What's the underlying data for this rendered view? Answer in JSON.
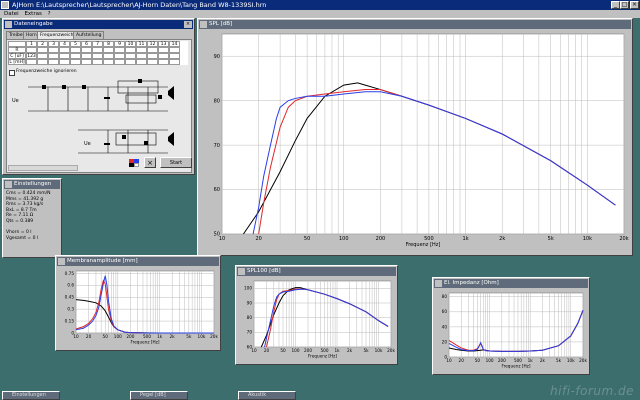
{
  "app": {
    "title": "AJHorn  E:\\Lautsprecher\\Lautsprecher\\AJ-Horn Daten\\Tang Band W8-1339SI.hrn"
  },
  "menu": [
    "Datei",
    "Extras",
    "?"
  ],
  "sidebar_controls": [
    "_",
    "□",
    "×"
  ],
  "data_window": {
    "title": "Dateneingabe",
    "tabs": [
      "Treiber",
      "Horn",
      "Frequenzweiche",
      "Aufstellung"
    ],
    "grid_cols": [
      "1",
      "2",
      "3",
      "4",
      "5",
      "6",
      "7",
      "8",
      "9",
      "10",
      "11",
      "12",
      "13",
      "14"
    ],
    "grid_rows": [
      "R [Ohm]",
      "C [uF]",
      "L [mH]"
    ],
    "c_value": "123",
    "checkbox_label": "Frequenzweiche ignorieren",
    "input_label_1": "Ue",
    "input_label_2": "Ue",
    "start_button": "Start",
    "close_button": "×"
  },
  "params_window": {
    "title": "Einstellungen",
    "lines": [
      "Cms = 0.424 mm/N",
      "Mms = 41.392 g",
      "Rms = 3.73 kg/s",
      "BxL = 8.7 Tm",
      "Re = 7.11 Ω",
      "Qts = 0.389",
      "",
      "Vhorn = 0 l",
      "Vgesamt = 0 l"
    ]
  },
  "colors": {
    "blue": "#2a3ee8",
    "red": "#e0282c",
    "black": "#000000",
    "bg": "#3d6e6e"
  },
  "charts": {
    "spl": {
      "title": "SPL [dB]",
      "xlabel": "Frequenz [Hz]",
      "x_ticks": [
        "10",
        "20",
        "50",
        "100",
        "200",
        "500",
        "1k",
        "2k",
        "5k",
        "10k",
        "20k"
      ],
      "y_ticks": [
        "50",
        "60",
        "70",
        "80",
        "90"
      ]
    },
    "excursion": {
      "title": "Membranamplitude [mm]",
      "xlabel": "Frequenz [Hz]",
      "x_ticks": [
        "10",
        "20",
        "50",
        "100",
        "200",
        "500",
        "1k",
        "2k",
        "5k",
        "10k",
        "20k"
      ],
      "y_ticks": [
        "0",
        "0.15",
        "0.3",
        "0.45",
        "0.6",
        "0.75"
      ]
    },
    "spl_small": {
      "title": "SPL100 [dB]",
      "xlabel": "Frequenz [Hz]",
      "x_ticks": [
        "10",
        "20",
        "50",
        "100",
        "200",
        "500",
        "1k",
        "2k",
        "5k",
        "10k",
        "20k"
      ],
      "y_ticks": [
        "60",
        "70",
        "80",
        "90",
        "100"
      ]
    },
    "impedance": {
      "title": "El. Impedanz [Ohm]",
      "xlabel": "Frequenz [Hz]",
      "x_ticks": [
        "10",
        "20",
        "50",
        "100",
        "200",
        "500",
        "1k",
        "2k",
        "5k",
        "10k",
        "20k"
      ],
      "y_ticks": [
        "0",
        "20",
        "40",
        "60",
        "80"
      ]
    }
  },
  "chart_data": [
    {
      "type": "line",
      "title": "SPL [dB]",
      "xlabel": "Frequenz [Hz]",
      "ylabel": "",
      "xscale": "log",
      "xlim": [
        10,
        20000
      ],
      "ylim": [
        50,
        95
      ],
      "series": [
        {
          "color": "#000000",
          "x": [
            15,
            20,
            30,
            40,
            50,
            70,
            100,
            130,
            150,
            200,
            300,
            500,
            1000,
            2000,
            5000,
            10000,
            17000
          ],
          "y": [
            50,
            55,
            64,
            71,
            76,
            81,
            83.5,
            84,
            83.5,
            82.5,
            81,
            79,
            76,
            72.5,
            66.5,
            61,
            56.5
          ]
        },
        {
          "color": "#e0282c",
          "x": [
            20,
            22,
            25,
            30,
            35,
            40,
            50,
            70,
            100,
            150,
            200,
            300,
            500,
            1000,
            2000,
            5000,
            10000,
            17000
          ],
          "y": [
            50,
            57,
            65,
            74,
            78.5,
            80,
            81,
            81.5,
            82,
            82.5,
            82.5,
            81,
            79,
            76,
            72.5,
            66.5,
            61,
            56.5
          ]
        },
        {
          "color": "#2a3ee8",
          "x": [
            18,
            20,
            22,
            25,
            28,
            30,
            35,
            40,
            50,
            70,
            100,
            150,
            200,
            300,
            500,
            1000,
            2000,
            5000,
            10000,
            17000
          ],
          "y": [
            50,
            56,
            63,
            70,
            76,
            78.5,
            80,
            80.5,
            81,
            81,
            81.5,
            82,
            82,
            81,
            79,
            76,
            72.5,
            66.5,
            61,
            56.5
          ]
        }
      ]
    },
    {
      "type": "line",
      "title": "Membranamplitude [mm]",
      "xlabel": "Frequenz [Hz]",
      "xscale": "log",
      "xlim": [
        10,
        20000
      ],
      "ylim": [
        0,
        0.78
      ],
      "series": [
        {
          "color": "#000000",
          "x": [
            10,
            15,
            20,
            30,
            40,
            50,
            60,
            70,
            80,
            100,
            150,
            200,
            500,
            1000,
            20000
          ],
          "y": [
            0.42,
            0.41,
            0.4,
            0.38,
            0.34,
            0.28,
            0.2,
            0.13,
            0.08,
            0.04,
            0.01,
            0.005,
            0.001,
            0,
            0
          ]
        },
        {
          "color": "#e0282c",
          "x": [
            10,
            15,
            20,
            25,
            30,
            35,
            40,
            45,
            50,
            55,
            60,
            70,
            80,
            100,
            150,
            200,
            500,
            20000
          ],
          "y": [
            0.05,
            0.08,
            0.12,
            0.18,
            0.26,
            0.38,
            0.55,
            0.66,
            0.62,
            0.45,
            0.3,
            0.15,
            0.08,
            0.04,
            0.01,
            0.005,
            0,
            0
          ]
        },
        {
          "color": "#2a3ee8",
          "x": [
            10,
            15,
            20,
            25,
            30,
            35,
            40,
            45,
            50,
            55,
            60,
            70,
            80,
            100,
            150,
            200,
            500,
            20000
          ],
          "y": [
            0.04,
            0.06,
            0.1,
            0.15,
            0.22,
            0.32,
            0.48,
            0.62,
            0.72,
            0.6,
            0.4,
            0.18,
            0.09,
            0.04,
            0.01,
            0.005,
            0,
            0
          ]
        }
      ]
    },
    {
      "type": "line",
      "title": "SPL100 [dB]",
      "xlabel": "Frequenz [Hz]",
      "xscale": "log",
      "xlim": [
        10,
        20000
      ],
      "ylim": [
        60,
        105
      ],
      "series": [
        {
          "color": "#000000",
          "x": [
            15,
            20,
            30,
            40,
            50,
            70,
            100,
            130,
            200,
            500,
            1000,
            2000,
            5000,
            10000,
            17000
          ],
          "y": [
            60,
            68,
            82,
            90,
            95,
            99,
            100.5,
            100.5,
            99,
            96,
            93,
            89.5,
            84,
            78,
            74
          ]
        },
        {
          "color": "#e0282c",
          "x": [
            20,
            25,
            30,
            35,
            40,
            50,
            70,
            100,
            150,
            200,
            500,
            1000,
            2000,
            5000,
            10000,
            17000
          ],
          "y": [
            60,
            72,
            84,
            92,
            96,
            98,
            98.5,
            99.5,
            99.5,
            99,
            96,
            93,
            89.5,
            84,
            78,
            74
          ]
        },
        {
          "color": "#2a3ee8",
          "x": [
            18,
            20,
            25,
            30,
            35,
            40,
            50,
            70,
            100,
            150,
            200,
            500,
            1000,
            2000,
            5000,
            10000,
            17000
          ],
          "y": [
            60,
            66,
            78,
            88,
            94,
            96,
            97.5,
            98,
            99,
            99.5,
            99,
            96,
            93,
            89.5,
            84,
            78,
            74
          ]
        }
      ]
    },
    {
      "type": "line",
      "title": "El. Impedanz [Ohm]",
      "xlabel": "Frequenz [Hz]",
      "xscale": "log",
      "xlim": [
        10,
        20000
      ],
      "ylim": [
        0,
        85
      ],
      "series": [
        {
          "color": "#000000",
          "x": [
            10,
            15,
            20,
            30,
            40,
            50,
            60,
            70,
            80,
            100,
            200,
            500,
            1000,
            2000,
            5000,
            10000,
            15000,
            20000
          ],
          "y": [
            12,
            10,
            9,
            8,
            8,
            8.5,
            9,
            9.5,
            9,
            8,
            7.5,
            7.5,
            8,
            9,
            15,
            28,
            45,
            62
          ]
        },
        {
          "color": "#e0282c",
          "x": [
            10,
            15,
            20,
            30,
            40,
            50,
            55,
            60,
            65,
            70,
            80,
            100,
            200,
            500,
            1000,
            2000,
            5000,
            10000,
            15000,
            20000
          ],
          "y": [
            22,
            16,
            12,
            9,
            9,
            11,
            15,
            18,
            14,
            10,
            8.5,
            8,
            7.5,
            7.5,
            8,
            9,
            15,
            28,
            45,
            62
          ]
        },
        {
          "color": "#2a3ee8",
          "x": [
            10,
            15,
            20,
            30,
            40,
            50,
            55,
            60,
            65,
            70,
            80,
            100,
            200,
            500,
            1000,
            2000,
            5000,
            10000,
            15000,
            20000
          ],
          "y": [
            18,
            13,
            10,
            8.5,
            8.5,
            10,
            14,
            19,
            15,
            10,
            8.5,
            8,
            7.5,
            7.5,
            8,
            9,
            15,
            28,
            45,
            62
          ]
        }
      ]
    }
  ],
  "minimized": [
    "Einstellungen",
    "Pegel [dB]",
    "Akustik"
  ],
  "watermark": "hifi-forum.de"
}
